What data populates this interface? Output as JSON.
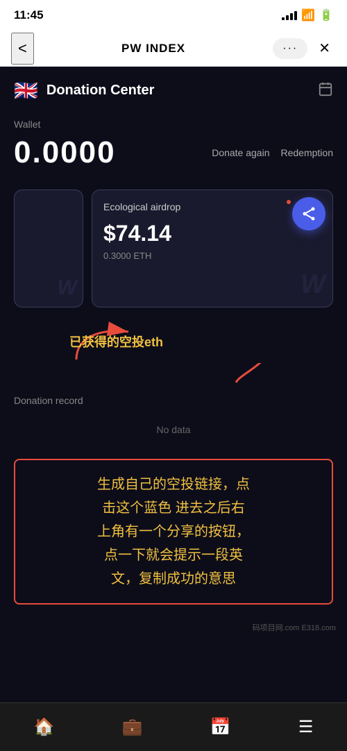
{
  "statusBar": {
    "time": "11:45",
    "signal": "signal",
    "wifi": "wifi",
    "battery": "battery"
  },
  "navBar": {
    "backLabel": "<",
    "title": "PW INDEX",
    "dotsLabel": "···",
    "closeLabel": "✕"
  },
  "header": {
    "flag": "🇬🇧",
    "title": "Donation Center",
    "calendarIcon": "📅"
  },
  "wallet": {
    "label": "Wallet",
    "amount": "0.0000",
    "donateAgainLabel": "Donate again",
    "redemptionLabel": "Redemption"
  },
  "airdropCard": {
    "title": "Ecological airdrop",
    "amount": "$74.14",
    "ethAmount": "0.3000 ETH"
  },
  "airdropGetLabel": "已获得的空投eth",
  "donationRecord": {
    "title": "Donation record",
    "noData": "No data"
  },
  "annotationText": "生成自己的空投链接，点\n击这个蓝色 进去之后右\n上角有一个分享的按钮，\n点一下就会提示一段英\n文，复制成功的意思",
  "tabBar": {
    "items": [
      {
        "icon": "🏠",
        "label": "home"
      },
      {
        "icon": "💼",
        "label": "wallet"
      },
      {
        "icon": "📅",
        "label": "calendar"
      },
      {
        "icon": "☰",
        "label": "menu"
      }
    ]
  },
  "watermark": "码项目网.com E318.com"
}
